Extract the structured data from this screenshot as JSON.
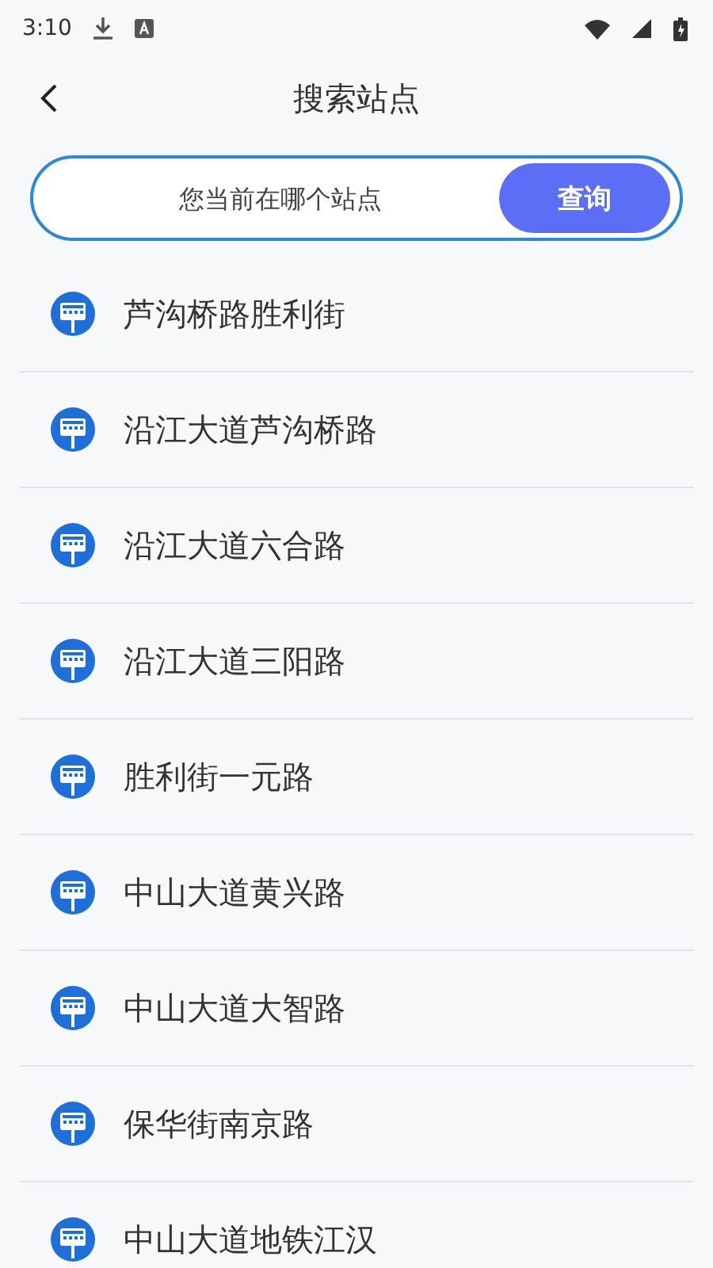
{
  "status_bar": {
    "time": "3:10"
  },
  "header": {
    "title": "搜索站点"
  },
  "search": {
    "placeholder": "您当前在哪个站点",
    "button": "查询"
  },
  "stations": [
    {
      "name": "芦沟桥路胜利街"
    },
    {
      "name": "沿江大道芦沟桥路"
    },
    {
      "name": "沿江大道六合路"
    },
    {
      "name": "沿江大道三阳路"
    },
    {
      "name": "胜利街一元路"
    },
    {
      "name": "中山大道黄兴路"
    },
    {
      "name": "中山大道大智路"
    },
    {
      "name": "保华街南京路"
    },
    {
      "name": "中山大道地铁江汉"
    }
  ]
}
